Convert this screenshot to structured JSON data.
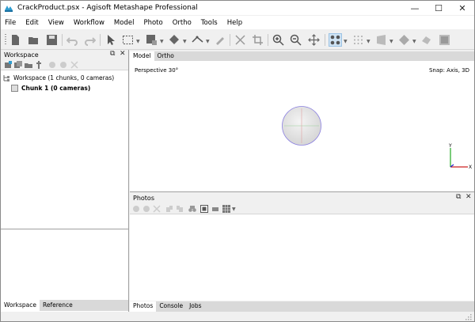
{
  "window": {
    "title": "CrackProduct.psx - Agisoft Metashape Professional",
    "controls": {
      "minimize": "—",
      "maximize": "☐",
      "close": "✕"
    }
  },
  "menu": [
    "File",
    "Edit",
    "View",
    "Workflow",
    "Model",
    "Photo",
    "Ortho",
    "Tools",
    "Help"
  ],
  "workspace": {
    "title": "Workspace",
    "root_label": "Workspace (1 chunks, 0 cameras)",
    "chunk_label": "Chunk 1 (0 cameras)",
    "tabs": [
      "Workspace",
      "Reference"
    ]
  },
  "view": {
    "tabs": [
      "Model",
      "Ortho"
    ],
    "perspective": "Perspective 30°",
    "snap": "Snap: Axis, 3D",
    "axis_x": "X",
    "axis_y": "Y"
  },
  "photos": {
    "title": "Photos"
  },
  "bottom_tabs": [
    "Photos",
    "Console",
    "Jobs"
  ],
  "colors": {
    "accent": "#2e9ccf",
    "axis_x": "#cc2222",
    "axis_y": "#22aa22",
    "sphere_ring": "#8a7fe0"
  }
}
